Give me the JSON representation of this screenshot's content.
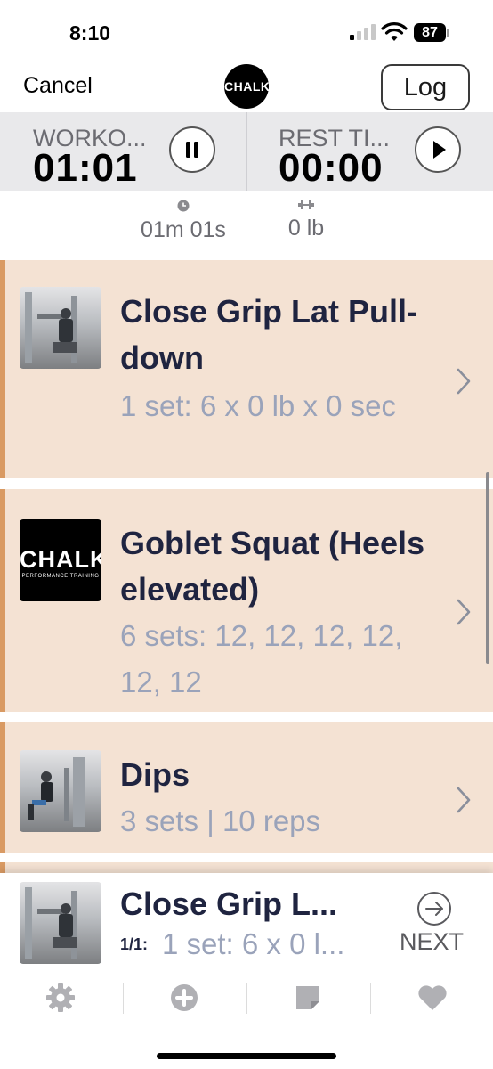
{
  "status_bar": {
    "time": "8:10",
    "battery": "87"
  },
  "nav": {
    "cancel_label": "Cancel",
    "logo_text": "CHALK",
    "log_label": "Log"
  },
  "timers": {
    "workout": {
      "label": "WORKO...",
      "value": "01:01"
    },
    "rest": {
      "label": "REST TI...",
      "value": "00:00"
    }
  },
  "summary": {
    "duration": "01m 01s",
    "weight": "0 lb"
  },
  "exercises": [
    {
      "title": "Close Grip Lat Pull-down",
      "detail": "1 set: 6 x 0 lb x 0 sec",
      "thumb": "photo"
    },
    {
      "title": "Goblet Squat (Heels elevated)",
      "detail": "6 sets: 12, 12, 12, 12, 12, 12",
      "thumb": "chalk",
      "thumb_text": "CHALK",
      "thumb_subtext": "PERFORMANCE TRAINING"
    },
    {
      "title": "Dips",
      "detail": "3 sets | 10 reps",
      "thumb": "photo"
    }
  ],
  "now_playing": {
    "title": "Close Grip L...",
    "prefix": "1/1:",
    "detail": "1 set: 6 x 0 l...",
    "next_label": "NEXT"
  },
  "tabs": [
    {
      "icon": "gear-icon"
    },
    {
      "icon": "plus-circle-icon"
    },
    {
      "icon": "note-icon"
    },
    {
      "icon": "heart-icon"
    }
  ],
  "colors": {
    "card_bg": "#f4e2d3",
    "card_accent": "#d99a63",
    "title": "#1f2440",
    "detail": "#9aa3ba"
  }
}
